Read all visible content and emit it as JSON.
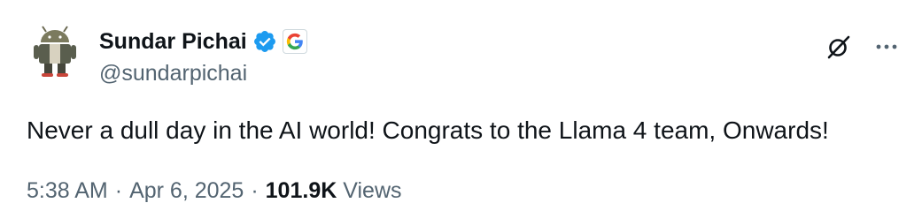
{
  "author": {
    "display_name": "Sundar Pichai",
    "handle": "@sundarpichai",
    "verified_color": "#1d9bf0"
  },
  "tweet": {
    "text": "Never a dull day in the AI world! Congrats to the Llama 4 team, Onwards!"
  },
  "meta": {
    "time": "5:38 AM",
    "separator": "·",
    "date": "Apr 6, 2025",
    "views_count": "101.9K",
    "views_label": "Views"
  },
  "colors": {
    "text_primary": "#0f1419",
    "text_secondary": "#536471",
    "accent": "#1d9bf0"
  },
  "icons": {
    "verified": "verified-badge-icon",
    "affiliation": "google-g-icon",
    "grok": "grok-icon",
    "more": "more-horizontal-icon"
  }
}
